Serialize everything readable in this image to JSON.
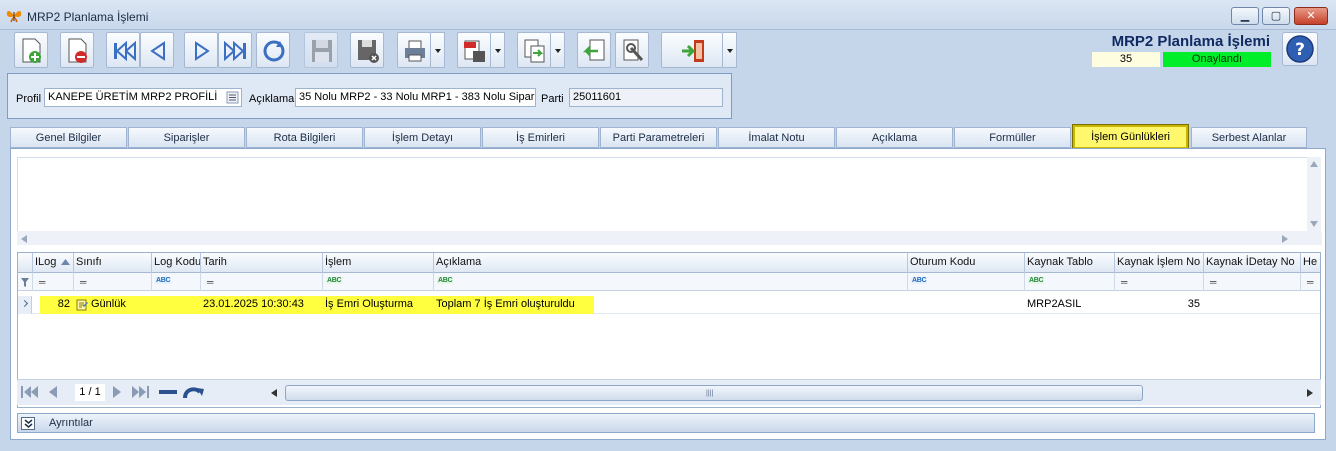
{
  "window": {
    "title": "MRP2 Planlama İşlemi"
  },
  "header": {
    "doc_title": "MRP2 Planlama İşlemi",
    "doc_number": "35",
    "status": "Onaylandı",
    "status_color": "#00ee2a"
  },
  "toolbar": {
    "buttons": [
      "new-icon",
      "delete-icon",
      "first-icon",
      "prev-icon",
      "next-icon",
      "last-icon",
      "refresh-icon",
      "save-icon",
      "save-close-icon",
      "print-icon",
      "pdf-icon",
      "export-icon",
      "import-icon",
      "tools-icon",
      "exit-icon"
    ]
  },
  "filters": {
    "profil_label": "Profil",
    "profil_value": "KANEPE ÜRETİM MRP2 PROFİLİ",
    "aciklama_label": "Açıklama",
    "aciklama_value": "35 Nolu MRP2 - 33 Nolu MRP1 - 383 Nolu Sipariş",
    "parti_label": "Parti",
    "parti_value": "25011601"
  },
  "tabs": [
    {
      "label": "Genel Bilgiler"
    },
    {
      "label": "Siparişler"
    },
    {
      "label": "Rota Bilgileri"
    },
    {
      "label": "İşlem Detayı"
    },
    {
      "label": "İş Emirleri"
    },
    {
      "label": "Parti Parametreleri"
    },
    {
      "label": "İmalat Notu"
    },
    {
      "label": "Açıklama"
    },
    {
      "label": "Formüller"
    },
    {
      "label": "İşlem Günlükleri"
    },
    {
      "label": "Serbest Alanlar"
    }
  ],
  "grid": {
    "columns": [
      "ILog",
      "Sınıfı",
      "Log Kodu",
      "Tarih",
      "İşlem",
      "Açıklama",
      "Oturum Kodu",
      "Kaynak Tablo",
      "Kaynak İşlem No",
      "Kaynak İDetay No",
      "He"
    ],
    "rows": [
      {
        "ilog": "82",
        "sinifi": "Günlük",
        "log_kodu": "",
        "tarih": "23.01.2025 10:30:43",
        "islem": "İş Emri Oluşturma",
        "aciklama": "Toplam 7 İş Emri oluşturuldu",
        "oturum_kodu": "",
        "kaynak_tablo": "MRP2ASIL",
        "kaynak_islem_no": "35",
        "kaynak_idetay_no": ""
      }
    ]
  },
  "navigator": {
    "page": "1 / 1"
  },
  "details": {
    "label": "Ayrıntılar"
  },
  "colors": {
    "highlight": "#ffff40",
    "active_tab": "#fff86c",
    "title_color": "#102a62"
  }
}
